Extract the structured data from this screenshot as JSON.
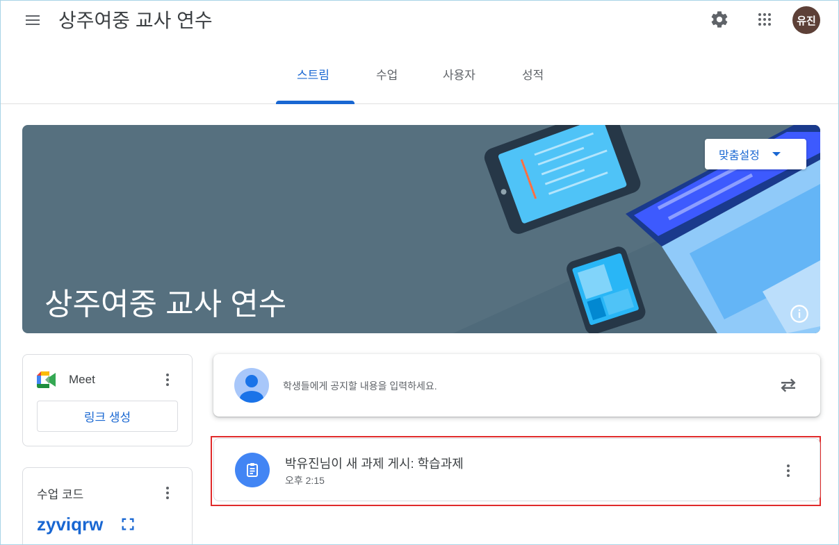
{
  "header": {
    "title": "상주여중 교사 연수",
    "avatar_initials": "유진"
  },
  "tabs": [
    {
      "label": "스트림",
      "active": true
    },
    {
      "label": "수업",
      "active": false
    },
    {
      "label": "사용자",
      "active": false
    },
    {
      "label": "성적",
      "active": false
    }
  ],
  "banner": {
    "title": "상주여중 교사 연수",
    "customize_label": "맞춤설정"
  },
  "meet": {
    "label": "Meet",
    "link_button": "링크 생성"
  },
  "class_code": {
    "label": "수업 코드",
    "value": "zyviqrw"
  },
  "announce": {
    "placeholder": "학생들에게 공지할 내용을 입력하세요."
  },
  "posts": [
    {
      "title": "박유진님이 새 과제 게시: 학습과제",
      "time": "오후 2:15"
    }
  ],
  "colors": {
    "accent": "#1967d2",
    "banner_bg": "#56707f",
    "highlight": "#e02b2b",
    "avatar_bg": "#5d4037"
  }
}
